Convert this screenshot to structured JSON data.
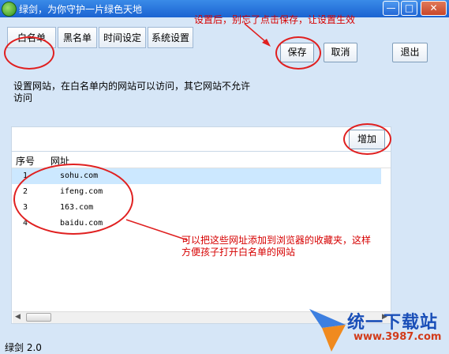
{
  "window": {
    "title": "绿剑，为你守护一片绿色天地",
    "minimize": "—",
    "maximize": "□",
    "close": "✕"
  },
  "annotations": {
    "top_note": "设置后，别忘了点击保存，让设置生效",
    "list_note": "可以把这些网址添加到浏览器的收藏夹，这样方便孩子打开白名单的网站",
    "color": "#e02020"
  },
  "tabs": [
    {
      "label": "白名单"
    },
    {
      "label": "黑名单"
    },
    {
      "label": "时间设定"
    },
    {
      "label": "系统设置"
    }
  ],
  "toolbar": {
    "save_label": "保存",
    "cancel_label": "取消",
    "exit_label": "退出"
  },
  "main": {
    "description": "设置网站，在白名单内的网站可以访问，其它网站不允许访问",
    "add_label": "增加"
  },
  "table": {
    "columns": [
      "序号",
      "网址"
    ],
    "rows": [
      {
        "no": "1",
        "url": "sohu.com"
      },
      {
        "no": "2",
        "url": "ifeng.com"
      },
      {
        "no": "3",
        "url": "163.com"
      },
      {
        "no": "4",
        "url": "baidu.com"
      }
    ]
  },
  "status": {
    "text": "绿剑 2.0"
  },
  "watermark": {
    "brand": "统一下载站",
    "url": "www.3987.com"
  }
}
